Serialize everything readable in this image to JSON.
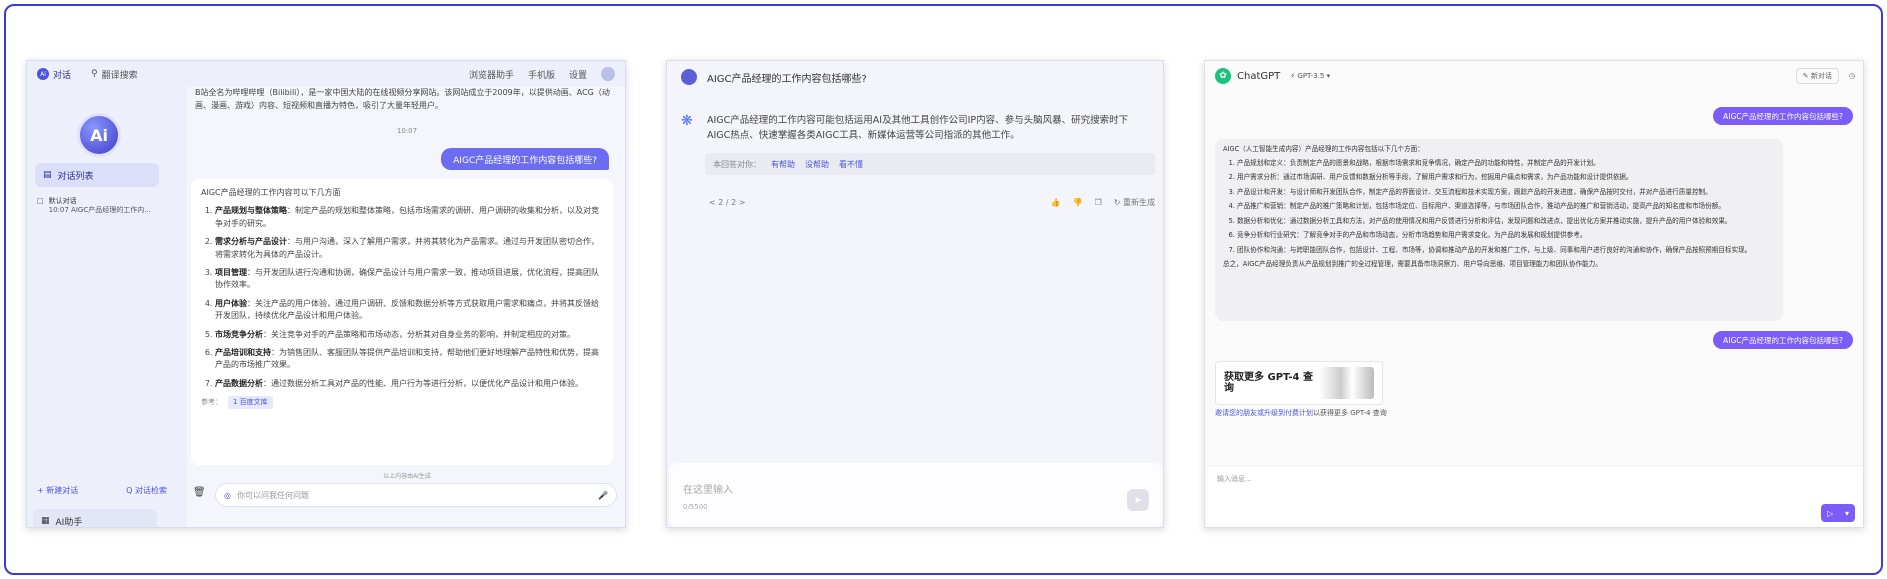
{
  "panel1": {
    "tabs": [
      {
        "label": "对话",
        "icon": "ai-logo-icon"
      },
      {
        "label": "翻译搜索",
        "icon": "search-icon"
      }
    ],
    "top_right": [
      "浏览器助手",
      "手机版",
      "设置"
    ],
    "logo_text": "Ai",
    "sidebar_active": "对话列表",
    "conversation": {
      "title": "默认对话",
      "time": "10:07",
      "preview": "AIGC产品经理的工作内..."
    },
    "new_chat": "+ 新建对话",
    "search_chat": "Q 对话检索",
    "ai_helper": "AI助手",
    "intro_text": "B站全名为哔哩哔哩（Bilibili），是一家中国大陆的在线视频分享网站。该网站成立于2009年，以提供动画、ACG（动画、漫画、游戏）内容、短视频和直播为特色，吸引了大量年轻用户。",
    "time": "10:07",
    "user_question": "AIGC产品经理的工作内容包括哪些?",
    "answer_head": "AIGC产品经理的工作内容可以下几方面",
    "answer_items": [
      {
        "title": "产品规划与整体策略",
        "body": "：制定产品的规划和整体策略，包括市场需求的调研、用户调研的收集和分析，以及对竞争对手的研究。"
      },
      {
        "title": "需求分析与产品设计",
        "body": "：与用户沟通，深入了解用户需求，并将其转化为产品需求。通过与开发团队密切合作，将需求转化为具体的产品设计。"
      },
      {
        "title": "项目管理",
        "body": "：与开发团队进行沟通和协调，确保产品设计与用户需求一致，推动项目进展，优化流程，提高团队协作效率。"
      },
      {
        "title": "用户体验",
        "body": "：关注产品的用户体验，通过用户调研、反馈和数据分析等方式获取用户需求和痛点，并将其反馈给开发团队，持续优化产品设计和用户体验。"
      },
      {
        "title": "市场竞争分析",
        "body": "：关注竞争对手的产品策略和市场动态，分析其对自身业务的影响，并制定相应的对策。"
      },
      {
        "title": "产品培训和支持",
        "body": "：为销售团队、客服团队等提供产品培训和支持，帮助他们更好地理解产品特性和优势，提高产品的市场推广效果。"
      },
      {
        "title": "产品数据分析",
        "body": "：通过数据分析工具对产品的性能、用户行为等进行分析，以便优化产品设计和用户体验。"
      }
    ],
    "ref_label": "参考：",
    "ref_chip": "1 百度文库",
    "ai_generated": "以上内容由AI生成",
    "input_placeholder": "你可以问我任何问题"
  },
  "panel2": {
    "question": "AIGC产品经理的工作内容包括哪些?",
    "answer": "AIGC产品经理的工作内容可能包括运用AI及其他工具创作公司IP内容、参与头脑风暴、研究搜索时下AIGC热点、快速掌握各类AIGC工具、新媒体运营等公司指派的其他工作。",
    "feedback_label": "本回答对你：",
    "feedback_options": [
      "有帮助",
      "没帮助",
      "看不懂"
    ],
    "pager": "< 2 / 2 >",
    "regenerate": "重新生成",
    "input_placeholder": "在这里输入",
    "counter": "0/5500"
  },
  "panel3": {
    "brand": "ChatGPT",
    "model": "GPT-3.5",
    "new_chat": "新对话",
    "user_q1": "AIGC产品经理的工作内容包括哪些?",
    "answer_head": "AIGC（人工智能生成内容）产品经理的工作内容包括以下几个方面：",
    "answer_items": [
      "产品规划和定义：负责制定产品的愿景和战略，根据市场需求和竞争情况，确定产品的功能和特性，并制定产品的开发计划。",
      "用户需求分析：通过市场调研、用户反馈和数据分析等手段，了解用户需求和行为，挖掘用户痛点和需求，为产品功能和设计提供依据。",
      "产品设计和开发：与设计师和开发团队合作，制定产品的界面设计、交互流程和技术实现方案，跟踪产品的开发进度，确保产品按时交付，并对产品进行质量控制。",
      "产品推广和营销：制定产品的推广策略和计划，包括市场定位、目标用户、渠道选择等，与市场团队合作，推动产品的推广和营销活动，提高产品的知名度和市场份额。",
      "数据分析和优化：通过数据分析工具和方法，对产品的使用情况和用户反馈进行分析和评估，发现问题和改进点，提出优化方案并推动实施，提升产品的用户体验和效果。",
      "竞争分析和行业研究：了解竞争对手的产品和市场动态，分析市场趋势和用户需求变化，为产品的发展和规划提供参考。",
      "团队协作和沟通：与跨职能团队合作，包括设计、工程、市场等，协调和推动产品的开发和推广工作，与上级、同事和用户进行良好的沟通和协作，确保产品按照预期目标实现。"
    ],
    "answer_summary": "总之，AIGC产品经理负责从产品规划到推广的全过程管理，需要具备市场洞察力、用户导向思维、项目管理能力和团队协作能力。",
    "user_q2": "AIGC产品经理的工作内容包括哪些?",
    "promo_title": "获取更多 GPT-4 查询",
    "promo_link": "邀请您的朋友或升级到付费计划",
    "promo_suffix": "以获得更多 GPT-4 查询",
    "input_placeholder": "输入消息...",
    "colors": {
      "accent": "#7c5cf6",
      "gpt_green": "#19c37d"
    }
  }
}
